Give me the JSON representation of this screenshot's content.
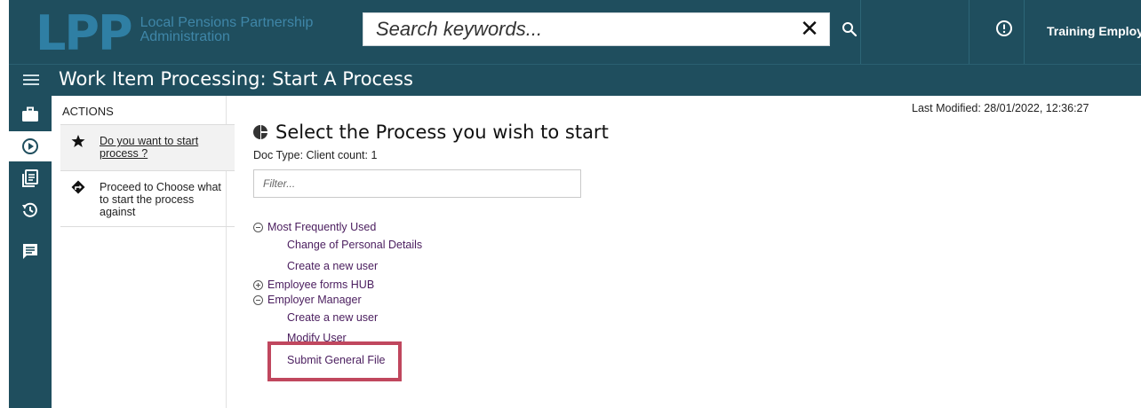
{
  "header": {
    "logo_text": "LPP",
    "org_name_line1": "Local Pensions Partnership",
    "org_name_line2": "Administration",
    "search_placeholder": "Search keywords...",
    "clear_glyph": "✕",
    "user_name": "Training Employer"
  },
  "titlebar": {
    "title": "Work Item Processing: Start A Process"
  },
  "rail": {
    "items": [
      {
        "icon": "briefcase-icon",
        "active": false
      },
      {
        "icon": "play-circle-icon",
        "active": true
      },
      {
        "icon": "documents-icon",
        "active": false
      },
      {
        "icon": "history-icon",
        "active": false
      },
      {
        "icon": "message-icon",
        "active": false
      }
    ]
  },
  "actions": {
    "heading": "ACTIONS",
    "items": [
      {
        "icon": "star-icon",
        "label": "Do you want to start process ?"
      },
      {
        "icon": "direction-sign-icon",
        "label": "Proceed to Choose what to start the process against"
      }
    ]
  },
  "main": {
    "last_modified": "Last Modified: 28/01/2022, 12:36:27",
    "heading": "Select the Process you wish to start",
    "doc_type": "Doc Type: Client count: 1",
    "filter_placeholder": "Filter...",
    "tree": [
      {
        "label": "Most Frequently Used",
        "expanded": true,
        "children": [
          "Change of Personal Details",
          "Create a new user"
        ]
      },
      {
        "label": "Employee forms HUB",
        "expanded": false,
        "children": []
      },
      {
        "label": "Employer Manager",
        "expanded": true,
        "children": [
          "Create a new user",
          "Modify User",
          "Submit General File"
        ]
      }
    ]
  },
  "colors": {
    "header_bg": "#1f4e5e",
    "link_purple": "#4a1d5e",
    "highlight": "#c0475e"
  }
}
